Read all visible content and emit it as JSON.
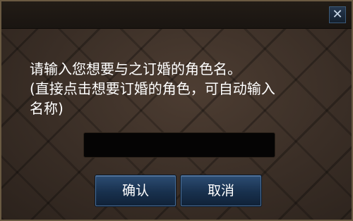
{
  "dialog": {
    "close_glyph": "✕",
    "close_icon": "close-icon",
    "message_line1": "请输入您想要与之订婚的角色名。",
    "message_line2": "(直接点击想要订婚的角色，可自动输入",
    "message_line3": "名称)",
    "input_value": "",
    "confirm_label": "确认",
    "cancel_label": "取消"
  },
  "colors": {
    "button_blue": "#1f3a5c",
    "background_brown": "#3b2f27",
    "title_bar": "#1e1813",
    "text": "#ffffff"
  }
}
